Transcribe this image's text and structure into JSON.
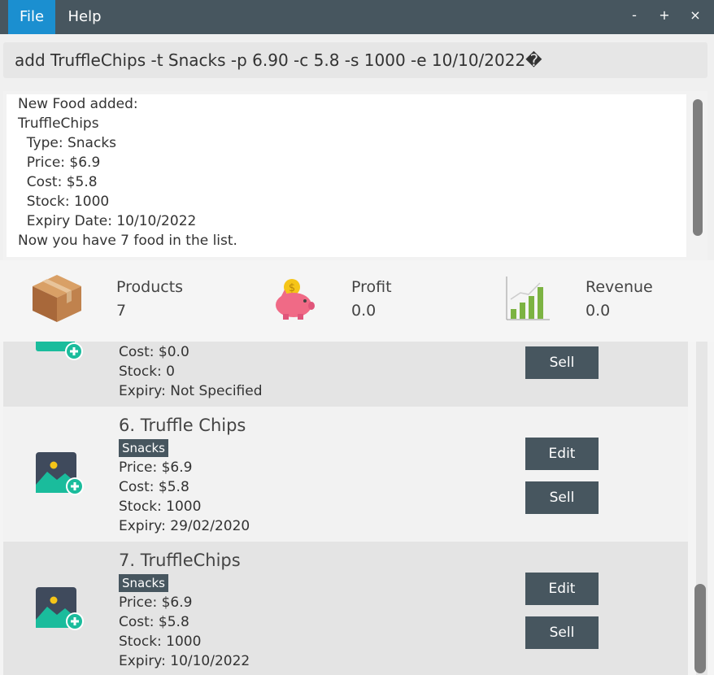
{
  "menu": {
    "file": "File",
    "help": "Help"
  },
  "window": {
    "minimize": "-",
    "maximize": "+",
    "close": "×"
  },
  "command_box": {
    "text": "add TruffleChips -t Snacks -p 6.90 -c 5.8 -s 1000 -e 10/10/2022�"
  },
  "result": {
    "text": "New Food added:\nTruffleChips\n  Type: Snacks\n  Price: $6.9\n  Cost: $5.8\n  Stock: 1000\n  Expiry Date: 10/10/2022\nNow you have 7 food in the list."
  },
  "stats": {
    "products": {
      "label": "Products",
      "value": "7",
      "icon": "box-icon"
    },
    "profit": {
      "label": "Profit",
      "value": "0.0",
      "icon": "piggy-bank-icon"
    },
    "revenue": {
      "label": "Revenue",
      "value": "0.0",
      "icon": "bar-chart-icon"
    }
  },
  "items": [
    {
      "cost": "Cost: $0.0",
      "stock": "Stock: 0",
      "expiry": "Expiry: Not Specified",
      "sell_label": "Sell"
    },
    {
      "title": "6.  Truffle Chips",
      "tag": "Snacks",
      "price": "Price: $6.9",
      "cost": "Cost: $5.8",
      "stock": "Stock: 1000",
      "expiry": "Expiry: 29/02/2020",
      "edit_label": "Edit",
      "sell_label": "Sell"
    },
    {
      "title": "7.  TruffleChips",
      "tag": "Snacks",
      "price": "Price: $6.9",
      "cost": "Cost: $5.8",
      "stock": "Stock: 1000",
      "expiry": "Expiry: 10/10/2022",
      "edit_label": "Edit",
      "sell_label": "Sell"
    }
  ],
  "colors": {
    "menubar": "#47565f",
    "menu_active": "#1b8fd0",
    "button": "#47565f",
    "icon_dark": "#3f4a5c",
    "icon_green": "#1abc9c",
    "icon_yellow": "#f5c518"
  }
}
